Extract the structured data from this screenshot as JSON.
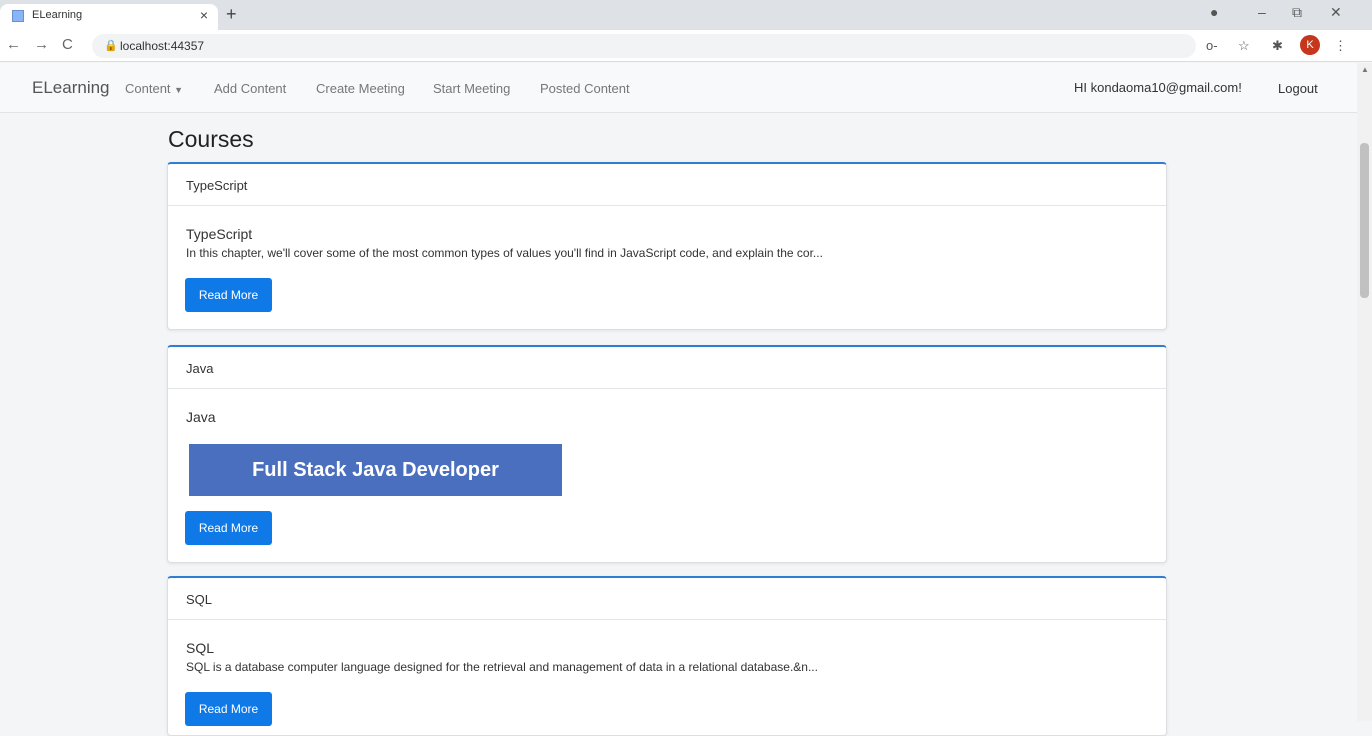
{
  "browser": {
    "tab_title": "ELearning",
    "tab_close": "×",
    "new_tab": "+",
    "back": "←",
    "forward": "→",
    "reload": "C",
    "url": "localhost:44357",
    "lock": "🔒",
    "profile_initial": "K",
    "icons": {
      "key": "o-",
      "star": "☆",
      "puzzle": "✱",
      "menu": "⋮",
      "minimize": "–",
      "restore": "⧉",
      "close": "✕",
      "record": "●"
    }
  },
  "navbar": {
    "brand": "ELearning",
    "links": [
      {
        "label": "Content"
      },
      {
        "label": "Add Content"
      },
      {
        "label": "Create Meeting"
      },
      {
        "label": "Start Meeting"
      },
      {
        "label": "Posted Content"
      }
    ],
    "greeting": "HI kondaoma10@gmail.com!",
    "logout": "Logout"
  },
  "main": {
    "heading": "Courses",
    "courses": [
      {
        "header": "TypeScript",
        "title": "TypeScript",
        "text": "In this chapter, we'll cover some of the most common types of values you'll find in JavaScript code, and explain the cor...",
        "button": "Read More"
      },
      {
        "header": "Java",
        "title": "Java",
        "image_text": "Full Stack Java Developer",
        "button": "Read More"
      },
      {
        "header": "SQL",
        "title": "SQL",
        "text": "SQL is a database computer language designed for the retrieval and management of data in a relational database.&n...",
        "button": "Read More"
      }
    ]
  },
  "colors": {
    "accent": "#2f7ed3",
    "button": "#1079e8",
    "banner": "#4b6fbf"
  }
}
